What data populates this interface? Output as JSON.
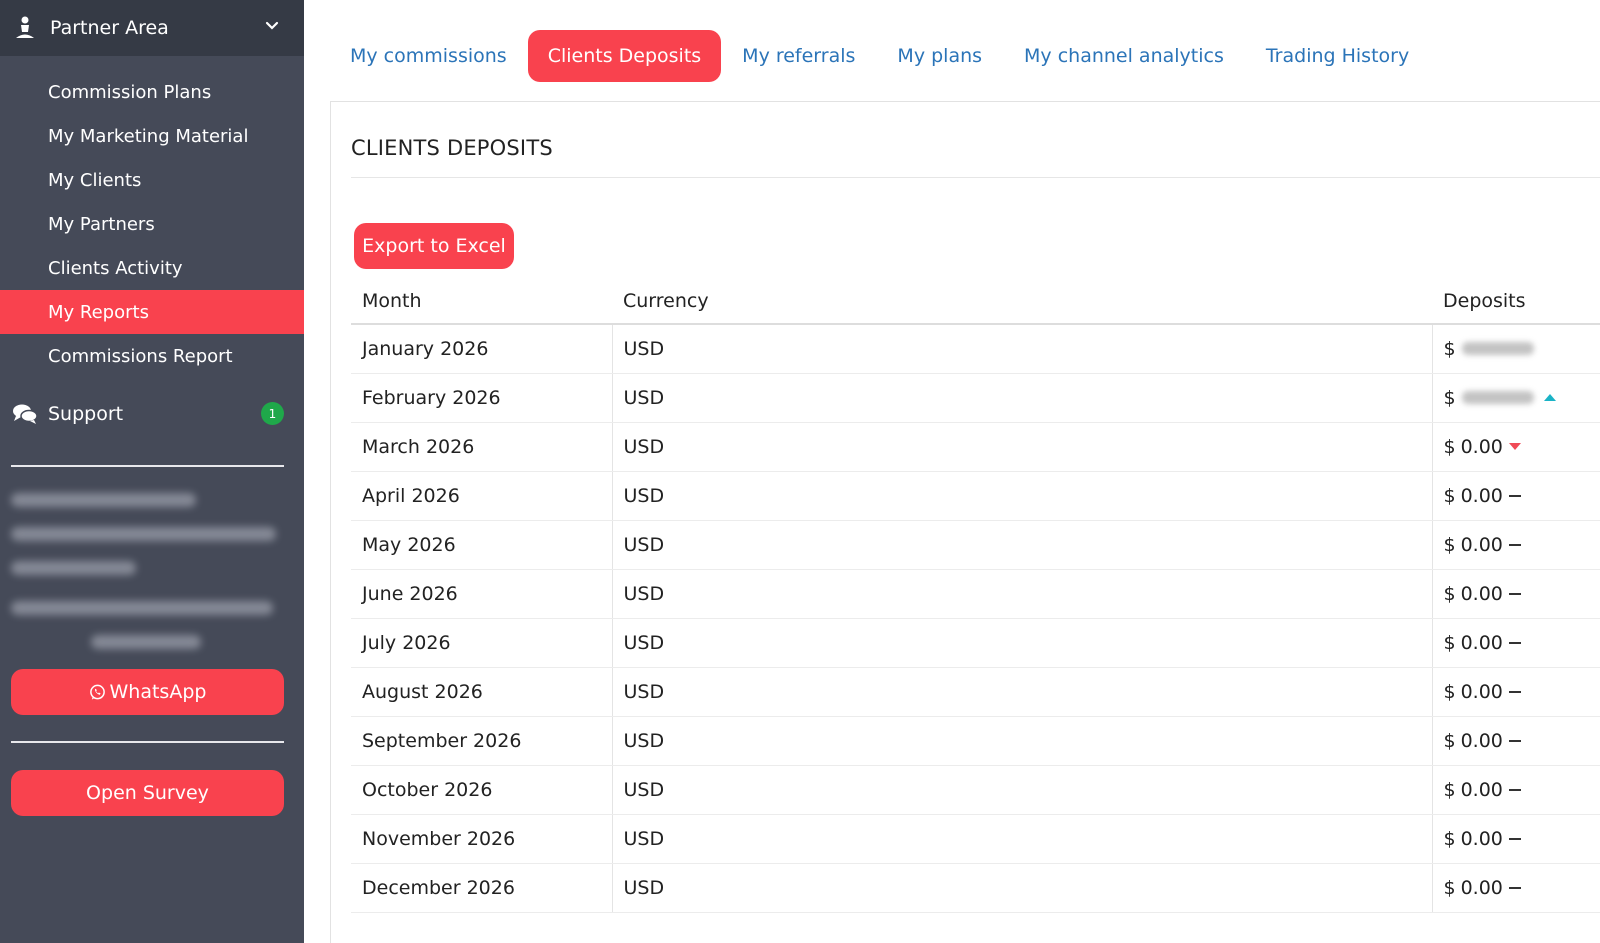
{
  "sidebar": {
    "header_title": "Partner Area",
    "items": [
      {
        "label": "Commission Plans",
        "active": false
      },
      {
        "label": "My Marketing Material",
        "active": false
      },
      {
        "label": "My Clients",
        "active": false
      },
      {
        "label": "My Partners",
        "active": false
      },
      {
        "label": "Clients Activity",
        "active": false
      },
      {
        "label": "My Reports",
        "active": true
      },
      {
        "label": "Commissions Report",
        "active": false
      }
    ],
    "support_label": "Support",
    "support_badge": "1",
    "whatsapp_label": "WhatsApp",
    "survey_label": "Open Survey"
  },
  "tabs": [
    {
      "label": "My commissions",
      "active": false
    },
    {
      "label": "Clients Deposits",
      "active": true
    },
    {
      "label": "My referrals",
      "active": false
    },
    {
      "label": "My plans",
      "active": false
    },
    {
      "label": "My channel analytics",
      "active": false
    },
    {
      "label": "Trading History",
      "active": false
    }
  ],
  "panel": {
    "title": "CLIENTS DEPOSITS",
    "export_label": "Export to Excel"
  },
  "table": {
    "headers": [
      "Month",
      "Currency",
      "Deposits"
    ],
    "rows": [
      {
        "month": "January 2026",
        "currency": "USD",
        "prefix": "$",
        "value": "",
        "trend": "none"
      },
      {
        "month": "February 2026",
        "currency": "USD",
        "prefix": "$",
        "value": "",
        "trend": "up"
      },
      {
        "month": "March 2026",
        "currency": "USD",
        "prefix": "$",
        "value": "0.00",
        "trend": "down"
      },
      {
        "month": "April 2026",
        "currency": "USD",
        "prefix": "$",
        "value": "0.00",
        "trend": "flat"
      },
      {
        "month": "May 2026",
        "currency": "USD",
        "prefix": "$",
        "value": "0.00",
        "trend": "flat"
      },
      {
        "month": "June 2026",
        "currency": "USD",
        "prefix": "$",
        "value": "0.00",
        "trend": "flat"
      },
      {
        "month": "July 2026",
        "currency": "USD",
        "prefix": "$",
        "value": "0.00",
        "trend": "flat"
      },
      {
        "month": "August 2026",
        "currency": "USD",
        "prefix": "$",
        "value": "0.00",
        "trend": "flat"
      },
      {
        "month": "September 2026",
        "currency": "USD",
        "prefix": "$",
        "value": "0.00",
        "trend": "flat"
      },
      {
        "month": "October 2026",
        "currency": "USD",
        "prefix": "$",
        "value": "0.00",
        "trend": "flat"
      },
      {
        "month": "November 2026",
        "currency": "USD",
        "prefix": "$",
        "value": "0.00",
        "trend": "flat"
      },
      {
        "month": "December 2026",
        "currency": "USD",
        "prefix": "$",
        "value": "0.00",
        "trend": "flat"
      }
    ]
  },
  "colors": {
    "accent": "#f9424e",
    "sidebar_bg": "#454a58",
    "sidebar_header_bg": "#353a45",
    "link": "#2b74b8",
    "badge": "#1fa84a",
    "trend_up": "#1ab3c6",
    "trend_down": "#f04a56"
  }
}
